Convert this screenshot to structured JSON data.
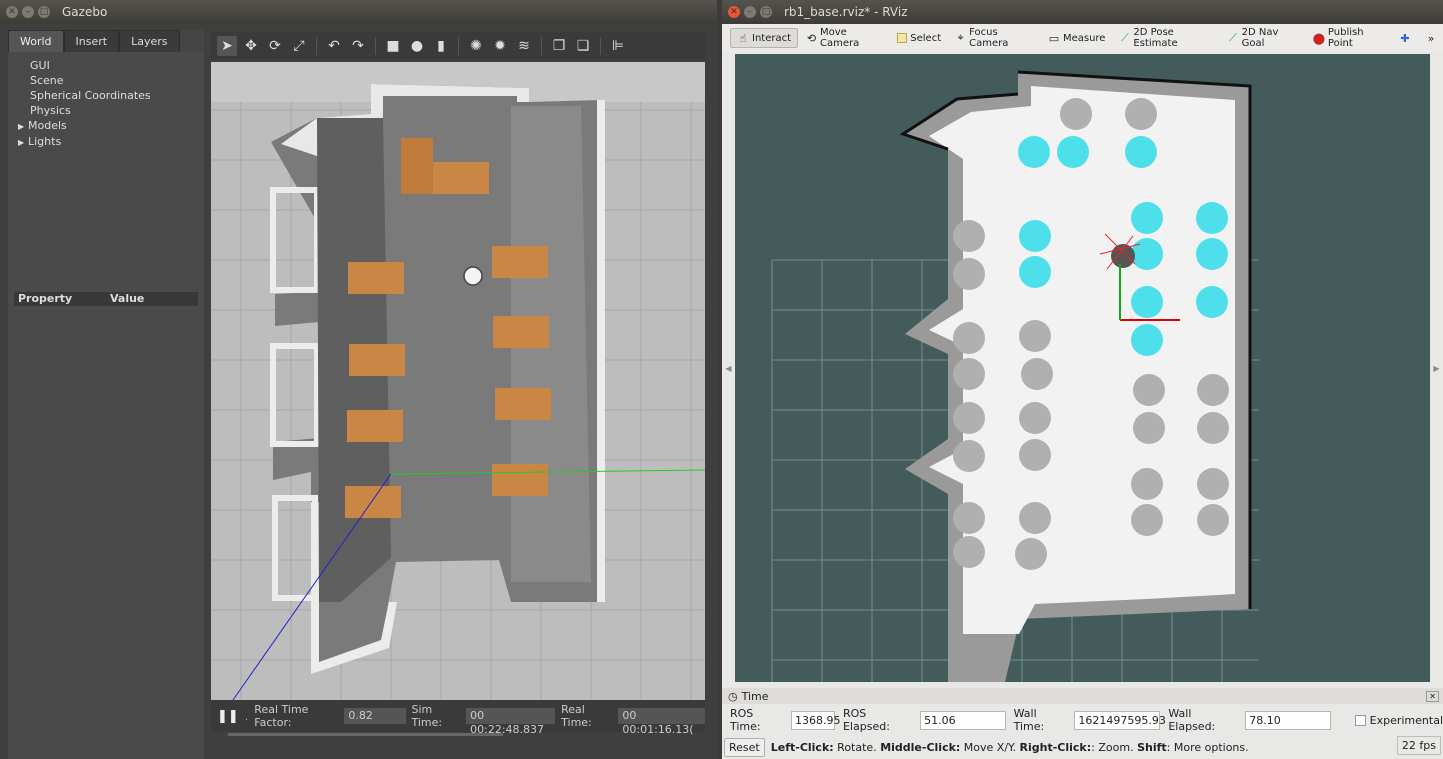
{
  "gazebo": {
    "title": "Gazebo",
    "tabs": [
      "World",
      "Insert",
      "Layers"
    ],
    "tree": [
      "GUI",
      "Scene",
      "Spherical Coordinates",
      "Physics",
      "Models",
      "Lights"
    ],
    "property_header": {
      "property": "Property",
      "value": "Value"
    },
    "status": {
      "rtf_label": "Real Time Factor:",
      "rtf_value": "0.82",
      "sim_label": "Sim Time:",
      "sim_value": "00 00:22:48.837",
      "real_label": "Real Time:",
      "real_value": "00 00:01:16.13("
    }
  },
  "rviz": {
    "title": "rb1_base.rviz* - RViz",
    "tools": [
      "Interact",
      "Move Camera",
      "Select",
      "Focus Camera",
      "Measure",
      "2D Pose Estimate",
      "2D Nav Goal",
      "Publish Point"
    ],
    "time_panel_title": "Time",
    "time": {
      "ros_time_label": "ROS Time:",
      "ros_time": "1368.95",
      "ros_elapsed_label": "ROS Elapsed:",
      "ros_elapsed": "51.06",
      "wall_time_label": "Wall Time:",
      "wall_time": "1621497595.93",
      "wall_elapsed_label": "Wall Elapsed:",
      "wall_elapsed": "78.10",
      "experimental": "Experimental"
    },
    "help": {
      "reset": "Reset",
      "left_click": "Left-Click:",
      "left_click_desc": " Rotate. ",
      "middle_click": "Middle-Click:",
      "middle_click_desc": " Move X/Y. ",
      "right_click": "Right-Click:",
      "right_click_desc": ": Zoom. ",
      "shift": "Shift",
      "shift_desc": ": More options.",
      "fps": "22 fps"
    }
  }
}
